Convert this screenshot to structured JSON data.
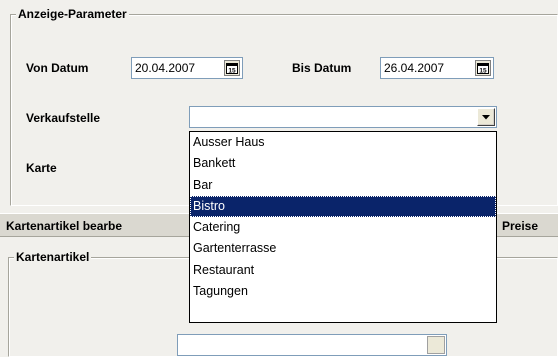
{
  "anzeige": {
    "legend": "Anzeige-Parameter",
    "von_label": "Von Datum",
    "von_value": "20.04.2007",
    "bis_label": "Bis Datum",
    "bis_value": "26.04.2007",
    "calendar_glyph": "15",
    "verkaufsstelle_label": "Verkaufstelle",
    "verkaufsstelle_value": "",
    "karte_label": "Karte"
  },
  "dropdown": {
    "options": [
      "Ausser Haus",
      "Bankett",
      "Bar",
      "Bistro",
      "Catering",
      "Gartenterrasse",
      "Restaurant",
      "Tagungen"
    ],
    "highlighted": "Bistro"
  },
  "tabs": {
    "bearbeiten_label": "Kartenartikel bearbe",
    "preise_label": "Preise"
  },
  "kartenartikel": {
    "legend": "Kartenartikel"
  },
  "icons": {
    "combo_arrow": "chevron-down-icon",
    "calendar": "calendar-icon"
  }
}
